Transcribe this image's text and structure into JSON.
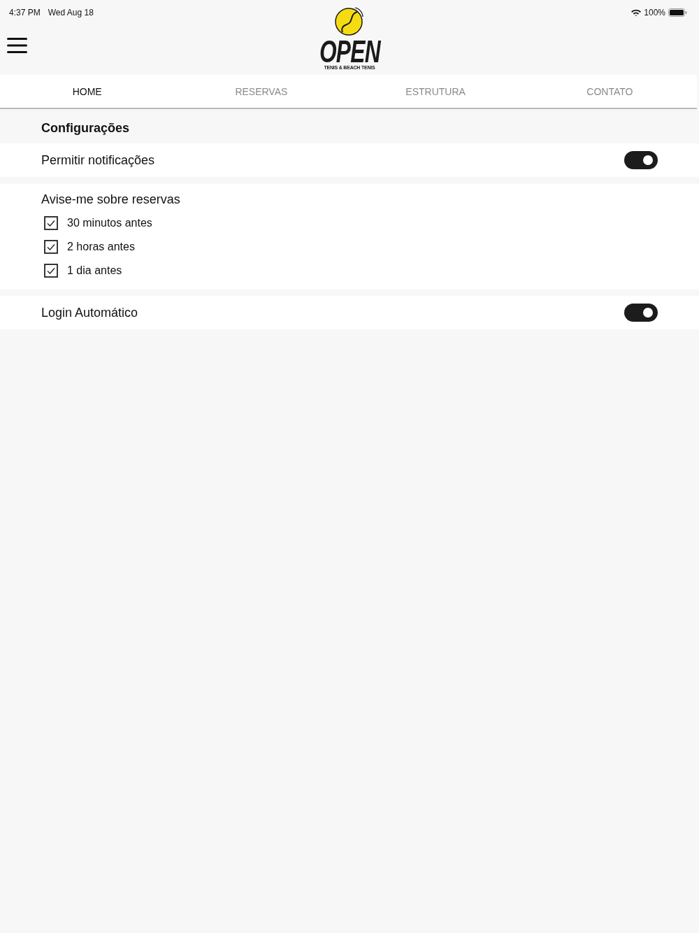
{
  "status_bar": {
    "time": "4:37 PM",
    "date": "Wed Aug 18",
    "battery": "100%"
  },
  "header": {
    "logo": {
      "title": "OPEN",
      "subtitle": "TENIS & BEACH TENIS"
    }
  },
  "tabs": [
    {
      "label": "HOME",
      "selected": true
    },
    {
      "label": "RESERVAS",
      "selected": false
    },
    {
      "label": "ESTRUTURA",
      "selected": false
    },
    {
      "label": "CONTATO",
      "selected": false
    }
  ],
  "settings": {
    "title": "Configurações",
    "sections": [
      {
        "kind": "toggle",
        "label": "Permitir notificações",
        "on": true
      },
      {
        "kind": "checklist",
        "label": "Avise-me sobre reservas",
        "options": [
          {
            "label": "30 minutos antes",
            "checked": true
          },
          {
            "label": "2 horas antes",
            "checked": true
          },
          {
            "label": "1 dia antes",
            "checked": true
          }
        ]
      },
      {
        "kind": "toggle",
        "label": "Login Automático",
        "on": true
      }
    ]
  }
}
